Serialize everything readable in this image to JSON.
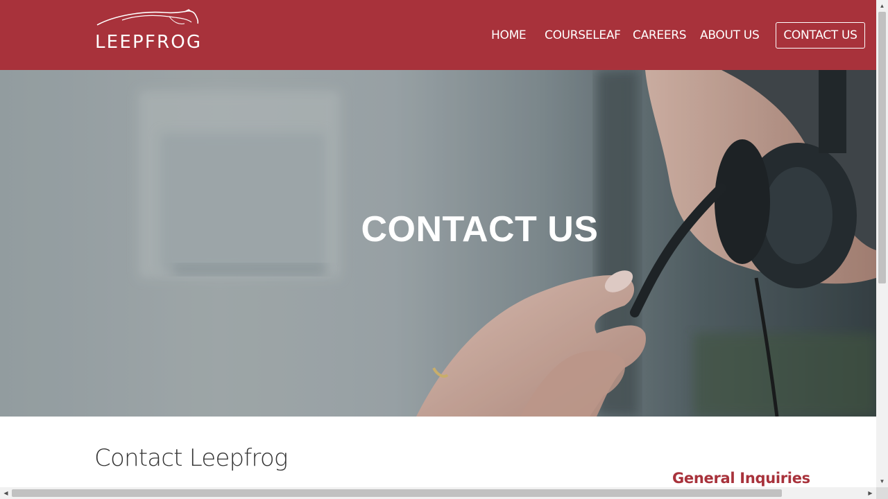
{
  "brand": {
    "logo_text": "LEEPFROG",
    "primary_color": "#a8323b"
  },
  "nav": {
    "items": [
      {
        "label": "HOME"
      },
      {
        "label": "COURSELEAF"
      },
      {
        "label": "CAREERS"
      },
      {
        "label": "ABOUT US"
      }
    ],
    "cta_label": "CONTACT US"
  },
  "hero": {
    "title": "CONTACT US",
    "image": "person-with-headset-photo"
  },
  "content": {
    "title": "Contact Leepfrog",
    "side_heading": "General Inquiries"
  },
  "icons": {
    "logo": "leaping-frog-icon",
    "scroll_up": "arrow-up-icon",
    "scroll_down": "arrow-down-icon",
    "scroll_left": "arrow-left-icon",
    "scroll_right": "arrow-right-icon"
  }
}
